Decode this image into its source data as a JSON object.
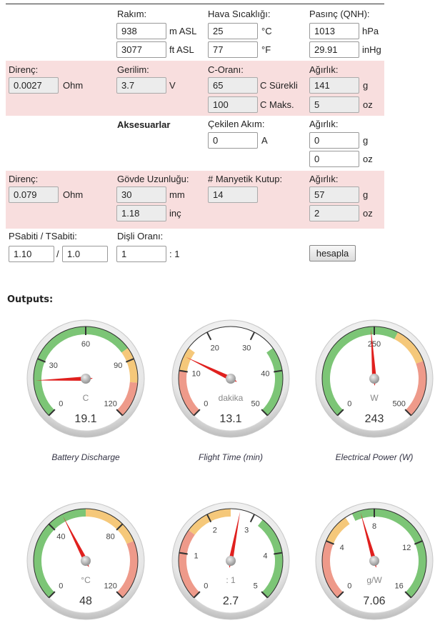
{
  "calc": {
    "rakim_label": "Rakım:",
    "rakim_m": "938",
    "rakim_m_unit": "m ASL",
    "rakim_ft": "3077",
    "rakim_ft_unit": "ft ASL",
    "hava_label": "Hava Sıcaklığı:",
    "hava_c": "25",
    "hava_c_unit": "°C",
    "hava_f": "77",
    "hava_f_unit": "°F",
    "basinc_label": "Pasınç (QNH):",
    "basinc_hpa": "1013",
    "basinc_hpa_unit": "hPa",
    "basinc_inhg": "29.91",
    "basinc_inhg_unit": "inHg",
    "bat_direnc_label": "Direnç:",
    "bat_direnc": "0.0027",
    "bat_direnc_unit": "Ohm",
    "gerilim_label": "Gerilim:",
    "gerilim": "3.7",
    "gerilim_unit": "V",
    "coran_label": "C-Oranı:",
    "coran_cont": "65",
    "coran_cont_unit": "C Sürekli",
    "coran_max": "100",
    "coran_max_unit": "C Maks.",
    "bat_agirlik_label": "Ağırlık:",
    "bat_agirlik_g": "141",
    "bat_agirlik_g_unit": "g",
    "bat_agirlik_oz": "5",
    "bat_agirlik_oz_unit": "oz",
    "aks_label": "Aksesuarlar",
    "cekilen_label": "Çekilen Akım:",
    "cekilen": "0",
    "cekilen_unit": "A",
    "aks_agirlik_label": "Ağırlık:",
    "aks_agirlik_g": "0",
    "aks_agirlik_g_unit": "g",
    "aks_agirlik_oz": "0",
    "aks_agirlik_oz_unit": "oz",
    "mot_direnc_label": "Direnç:",
    "mot_direnc": "0.079",
    "mot_direnc_unit": "Ohm",
    "govde_label": "Gövde Uzunluğu:",
    "govde_mm": "30",
    "govde_mm_unit": "mm",
    "govde_inc": "1.18",
    "govde_inc_unit": "inç",
    "kutup_label": "# Manyetik Kutup:",
    "kutup": "14",
    "mot_agirlik_label": "Ağırlık:",
    "mot_agirlik_g": "57",
    "mot_agirlik_g_unit": "g",
    "mot_agirlik_oz": "2",
    "mot_agirlik_oz_unit": "oz",
    "psabit_label": "PSabiti / TSabiti:",
    "psabit": "1.10",
    "psabit_sep": "/",
    "tsabit": "1.0",
    "disli_label": "Dişli Oranı:",
    "disli": "1",
    "disli_unit": ": 1",
    "hesapla": "hesapla"
  },
  "outputs_label": "Outputs:",
  "gauges": [
    {
      "unit": "C",
      "value": 19.1,
      "display": "19.1",
      "min": 0,
      "max": 120,
      "ticks": [
        "0",
        "30",
        "60",
        "90",
        "120"
      ],
      "caption": "Battery Discharge",
      "bands": [
        {
          "from": 0,
          "to": 84,
          "color": "#7cc576"
        },
        {
          "from": 84,
          "to": 102,
          "color": "#f5c87a"
        },
        {
          "from": 102,
          "to": 120,
          "color": "#ee9a8a"
        }
      ]
    },
    {
      "unit": "dakika",
      "value": 13.1,
      "display": "13.1",
      "min": 0,
      "max": 50,
      "ticks": [
        "0",
        "10",
        "20",
        "30",
        "40",
        "50"
      ],
      "caption": "Flight Time (min)",
      "bands": [
        {
          "from": 0,
          "to": 10,
          "color": "#ee9a8a"
        },
        {
          "from": 10,
          "to": 15,
          "color": "#f5c87a"
        },
        {
          "from": 35,
          "to": 50,
          "color": "#7cc576"
        }
      ]
    },
    {
      "unit": "W",
      "value": 243,
      "display": "243",
      "min": 0,
      "max": 500,
      "ticks": [
        "0",
        "250",
        "500"
      ],
      "caption": "Electrical Power (W)",
      "bands": [
        {
          "from": 0,
          "to": 300,
          "color": "#7cc576"
        },
        {
          "from": 300,
          "to": 380,
          "color": "#f5c87a"
        },
        {
          "from": 380,
          "to": 500,
          "color": "#ee9a8a"
        }
      ]
    },
    {
      "unit": "°C",
      "value": 48,
      "display": "48",
      "min": 0,
      "max": 120,
      "ticks": [
        "0",
        "40",
        "80",
        "120"
      ],
      "caption": "",
      "bands": [
        {
          "from": 0,
          "to": 60,
          "color": "#7cc576"
        },
        {
          "from": 60,
          "to": 90,
          "color": "#f5c87a"
        },
        {
          "from": 90,
          "to": 120,
          "color": "#ee9a8a"
        }
      ]
    },
    {
      "unit": ": 1",
      "value": 2.7,
      "display": "2.7",
      "min": 0,
      "max": 5,
      "ticks": [
        "0",
        "1",
        "2",
        "3",
        "4",
        "5"
      ],
      "caption": "",
      "bands": [
        {
          "from": 0,
          "to": 1.5,
          "color": "#ee9a8a"
        },
        {
          "from": 1.5,
          "to": 2.5,
          "color": "#f5c87a"
        },
        {
          "from": 3.2,
          "to": 5,
          "color": "#7cc576"
        }
      ]
    },
    {
      "unit": "g/W",
      "value": 7.06,
      "display": "7.06",
      "min": 0,
      "max": 16,
      "ticks": [
        "0",
        "4",
        "8",
        "12",
        "16"
      ],
      "caption": "",
      "bands": [
        {
          "from": 0,
          "to": 4,
          "color": "#ee9a8a"
        },
        {
          "from": 4,
          "to": 6,
          "color": "#f5c87a"
        },
        {
          "from": 6.5,
          "to": 16,
          "color": "#7cc576"
        }
      ]
    }
  ]
}
